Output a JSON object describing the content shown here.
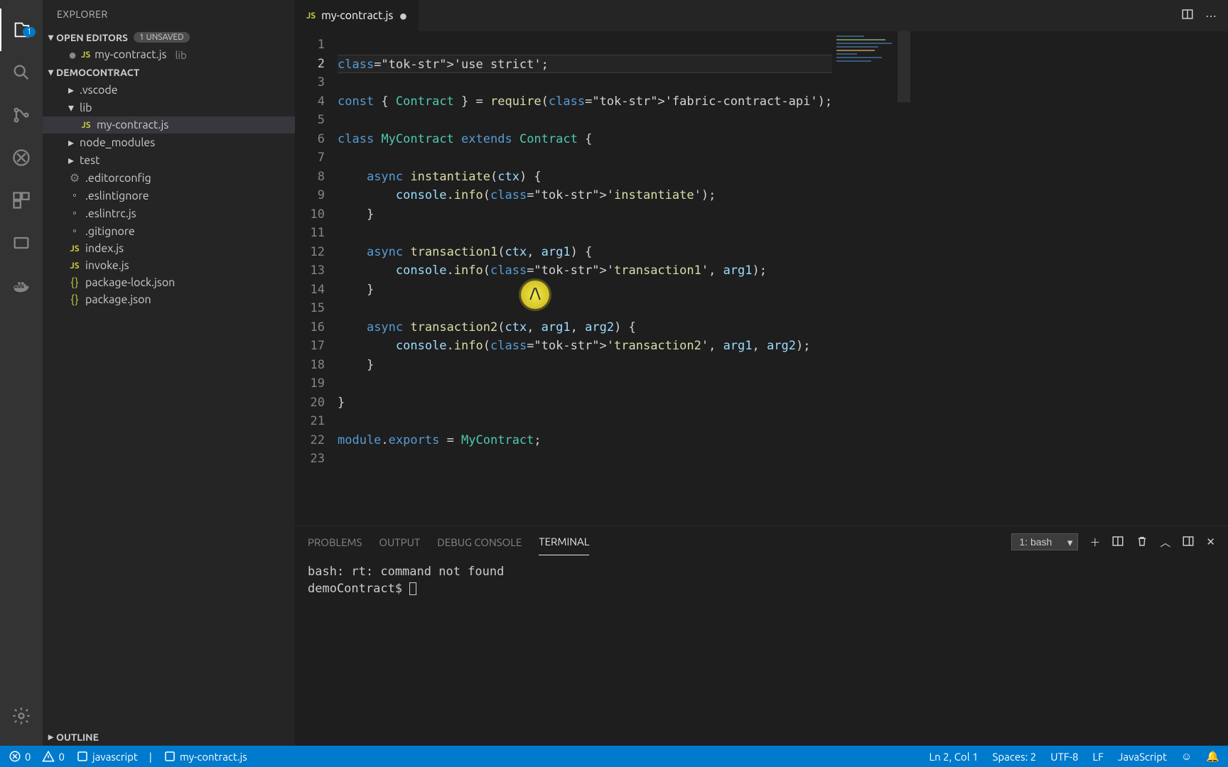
{
  "activity_badge": "1",
  "sidebar": {
    "title": "EXPLORER",
    "open_editors_label": "OPEN EDITORS",
    "unsaved_label": "1 UNSAVED",
    "open_editors": [
      {
        "name": "my-contract.js",
        "dir": "lib"
      }
    ],
    "workspace_label": "DEMOCONTRACT",
    "tree": [
      {
        "type": "folder",
        "name": ".vscode",
        "indent": 1,
        "expanded": false
      },
      {
        "type": "folder",
        "name": "lib",
        "indent": 1,
        "expanded": true
      },
      {
        "type": "file",
        "name": "my-contract.js",
        "icon": "js",
        "indent": 2,
        "selected": true
      },
      {
        "type": "folder",
        "name": "node_modules",
        "indent": 1,
        "expanded": false
      },
      {
        "type": "folder",
        "name": "test",
        "indent": 1,
        "expanded": false
      },
      {
        "type": "file",
        "name": ".editorconfig",
        "icon": "gear",
        "indent": 1
      },
      {
        "type": "file",
        "name": ".eslintignore",
        "icon": "circle",
        "indent": 1
      },
      {
        "type": "file",
        "name": ".eslintrc.js",
        "icon": "circle",
        "indent": 1
      },
      {
        "type": "file",
        "name": ".gitignore",
        "icon": "circle",
        "indent": 1
      },
      {
        "type": "file",
        "name": "index.js",
        "icon": "js",
        "indent": 1
      },
      {
        "type": "file",
        "name": "invoke.js",
        "icon": "js",
        "indent": 1
      },
      {
        "type": "file",
        "name": "package-lock.json",
        "icon": "json",
        "indent": 1
      },
      {
        "type": "file",
        "name": "package.json",
        "icon": "json",
        "indent": 1
      }
    ],
    "outline_label": "OUTLINE"
  },
  "tab": {
    "name": "my-contract.js"
  },
  "code_lines": [
    "",
    "'use strict';",
    "",
    "const { Contract } = require('fabric-contract-api');",
    "",
    "class MyContract extends Contract {",
    "",
    "    async instantiate(ctx) {",
    "        console.info('instantiate');",
    "    }",
    "",
    "    async transaction1(ctx, arg1) {",
    "        console.info('transaction1', arg1);",
    "    }",
    "",
    "    async transaction2(ctx, arg1, arg2) {",
    "        console.info('transaction2', arg1, arg2);",
    "    }",
    "",
    "}",
    "",
    "module.exports = MyContract;",
    ""
  ],
  "panel": {
    "tabs": [
      "PROBLEMS",
      "OUTPUT",
      "DEBUG CONSOLE",
      "TERMINAL"
    ],
    "active_tab": "TERMINAL",
    "terminal_selector": "1: bash",
    "terminal_lines": [
      "bash: rt: command not found",
      "demoContract$ "
    ]
  },
  "status": {
    "errors": "0",
    "warnings": "0",
    "lang_mode": "javascript",
    "file_path": "my-contract.js",
    "cursor": "Ln 2, Col 1",
    "spaces": "Spaces: 2",
    "encoding": "UTF-8",
    "eol": "LF",
    "language": "JavaScript"
  }
}
